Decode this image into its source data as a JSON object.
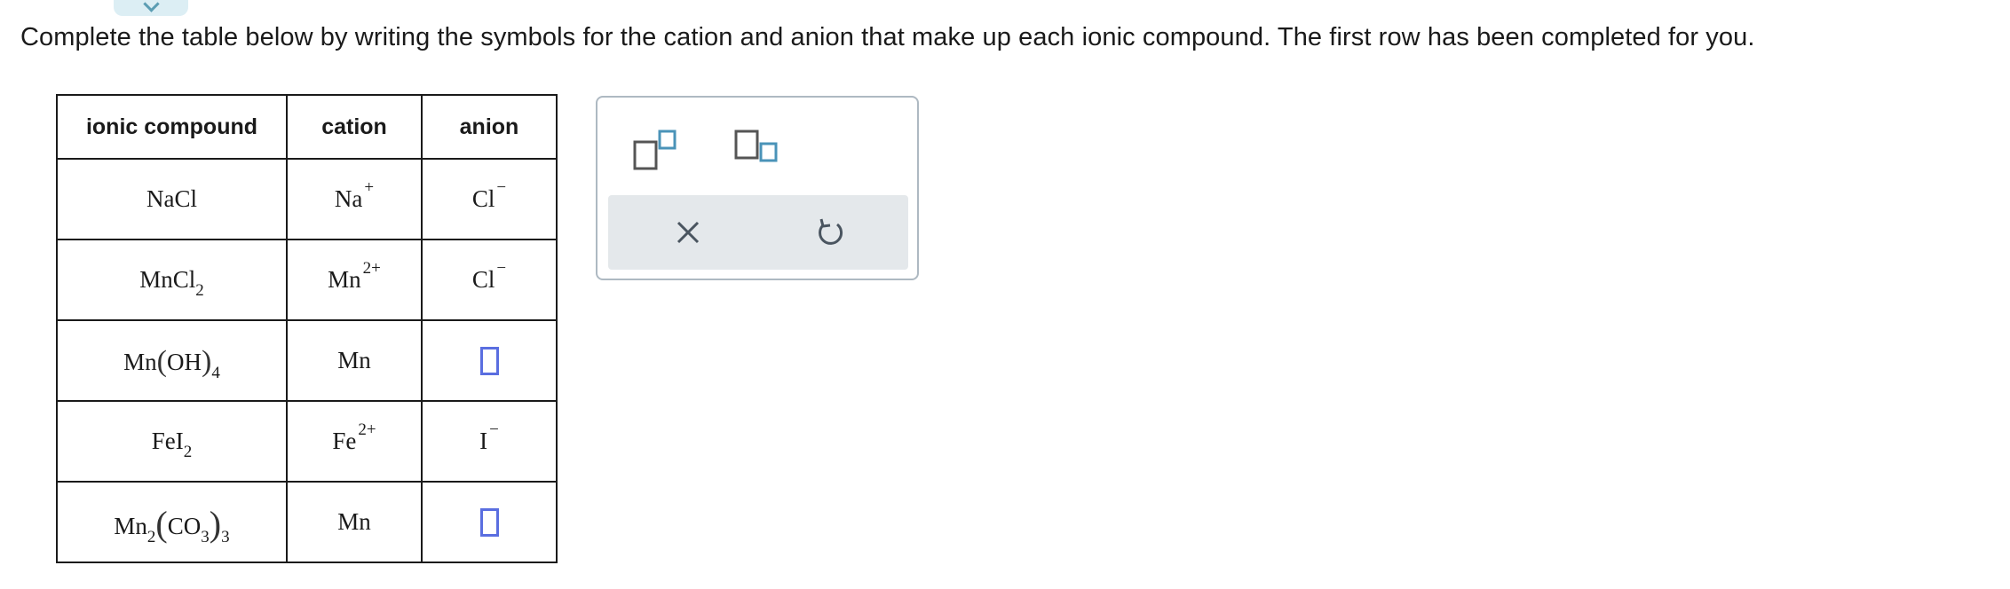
{
  "instructions": "Complete the table below by writing the symbols for the cation and anion that make up each ionic compound. The first row has been completed for you.",
  "table": {
    "headers": [
      "ionic compound",
      "cation",
      "anion"
    ],
    "rows": [
      {
        "compound": {
          "a": "NaCl"
        },
        "cation": {
          "symbol": "Na",
          "charge": "+"
        },
        "anion": {
          "symbol": "Cl",
          "charge": "−"
        }
      },
      {
        "compound": {
          "a": "MnCl",
          "a_sub": "2"
        },
        "cation": {
          "symbol": "Mn",
          "charge": "2+"
        },
        "anion": {
          "symbol": "Cl",
          "charge": "−"
        }
      },
      {
        "compound": {
          "a": "Mn",
          "open": "(",
          "b": "OH",
          "close": ")",
          "b_sub": "4"
        },
        "cation": {
          "symbol": "Mn"
        },
        "anion": {
          "input": true
        }
      },
      {
        "compound": {
          "a": "FeI",
          "a_sub": "2"
        },
        "cation": {
          "symbol": "Fe",
          "charge": "2+"
        },
        "anion": {
          "symbol": "I",
          "charge": "−"
        }
      },
      {
        "compound": {
          "a": "Mn",
          "a_sub": "2",
          "open": "(",
          "b": "CO",
          "b_inner_sub": "3",
          "close": ")",
          "b_sub": "3"
        },
        "cation": {
          "symbol": "Mn"
        },
        "anion": {
          "input": true
        }
      }
    ]
  },
  "toolbox": {
    "tools": [
      "superscript-icon",
      "subscript-icon"
    ],
    "actions": [
      "close-icon",
      "undo-icon"
    ]
  },
  "colors": {
    "input_border": "#5a6ee0",
    "tool_accent": "#4a93b8",
    "action_bar": "#e4e8eb",
    "toolbox_border": "#aeb9c2"
  }
}
